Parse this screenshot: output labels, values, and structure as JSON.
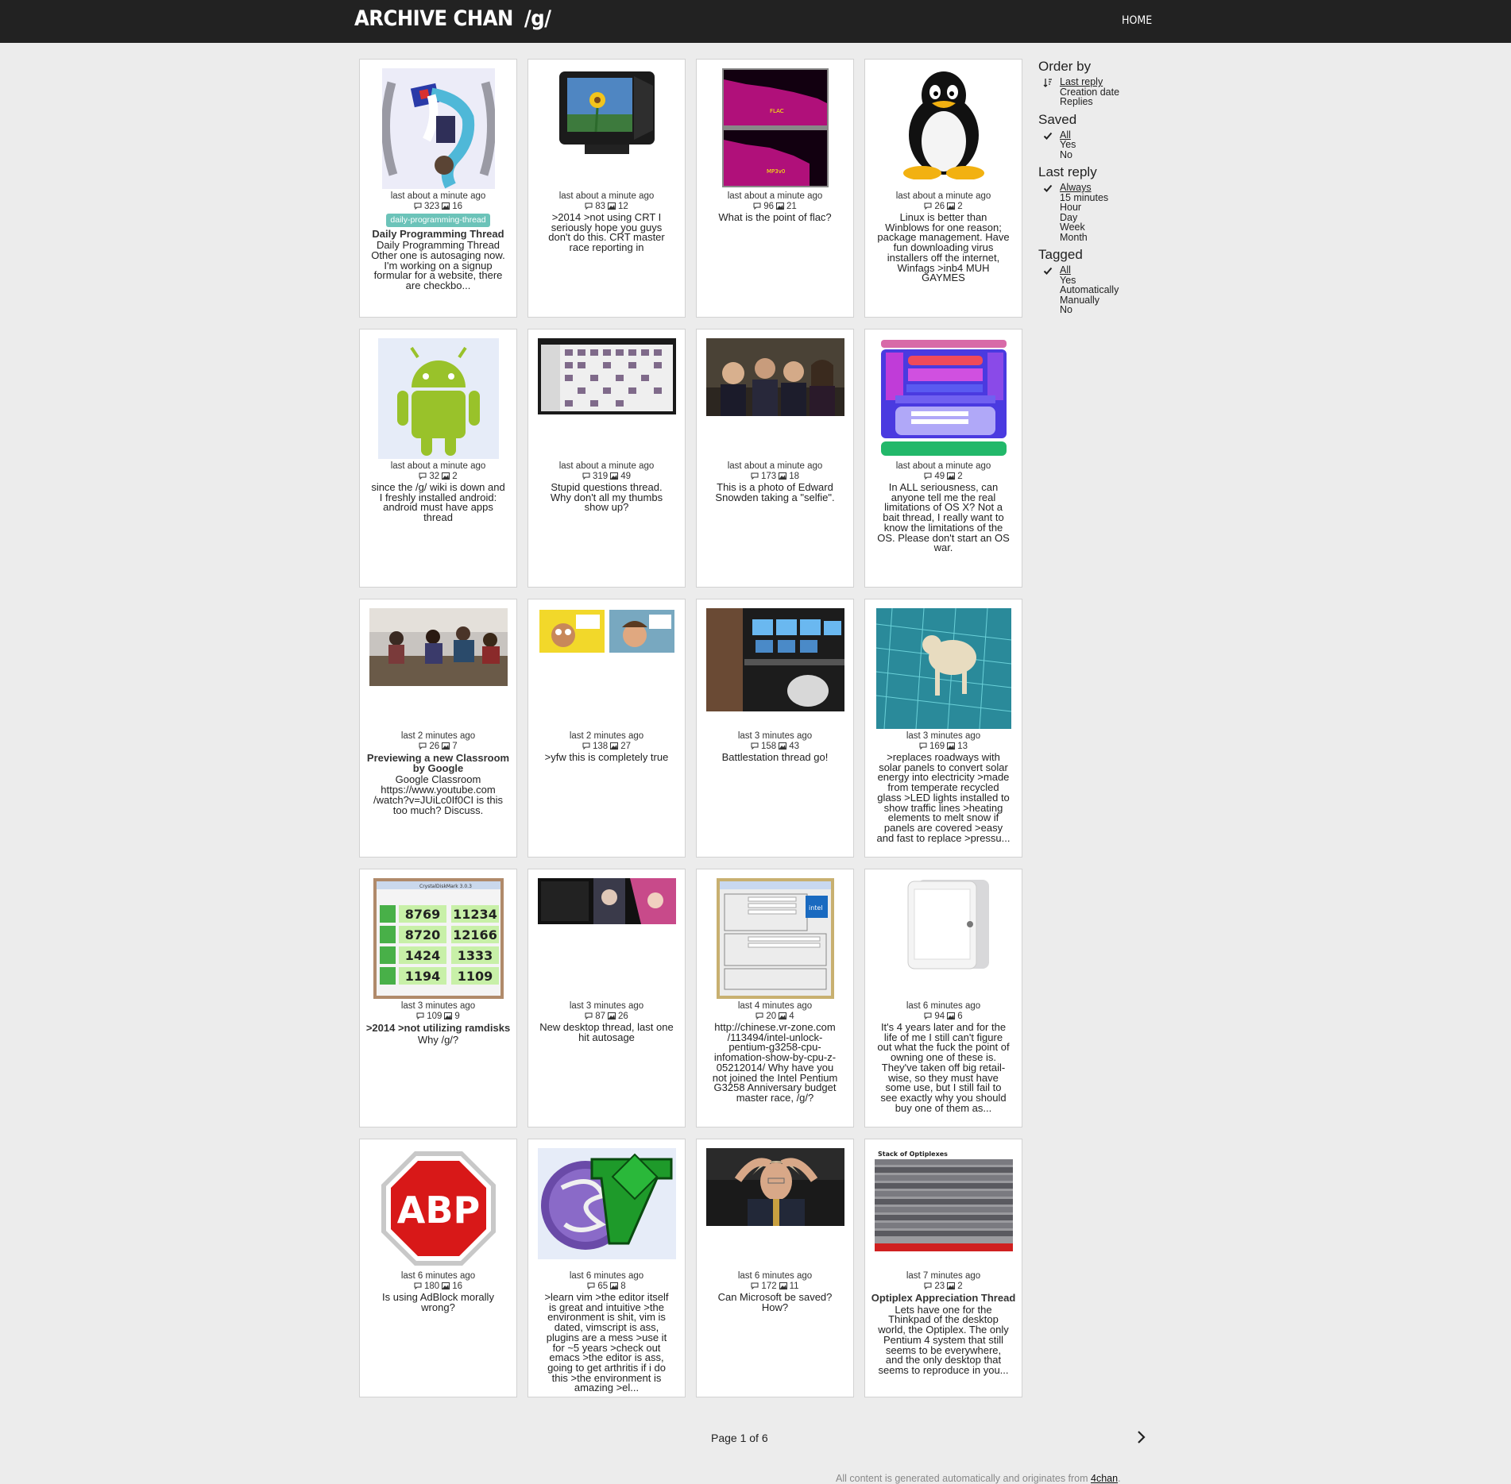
{
  "header": {
    "site_title": "ARCHIVE CHAN",
    "board": "/g/",
    "home_label": "HOME"
  },
  "threads": [
    {
      "last": "last about a minute ago",
      "replies": "323",
      "images": "16",
      "tag": "daily-programming-thread",
      "title": "Daily Programming Thread",
      "body": "Daily Programming Thread Other one is autosaging now. I'm working on a signup formular for a website, there are checkbo...",
      "thumb": "anime-girl"
    },
    {
      "last": "last about a minute ago",
      "replies": "83",
      "images": "12",
      "body": ">2014 >not using CRT I seriously hope you guys don't do this. CRT master race reporting in",
      "thumb": "crt-monitor"
    },
    {
      "last": "last about a minute ago",
      "replies": "96",
      "images": "21",
      "body": "What is the point of flac?",
      "thumb": "spectrogram"
    },
    {
      "last": "last about a minute ago",
      "replies": "26",
      "images": "2",
      "body": "Linux is better than Winblows for one reason; package management. Have fun downloading virus installers off the internet, Winfags >inb4 MUH GAYMES",
      "thumb": "tux"
    },
    {
      "last": "last about a minute ago",
      "replies": "32",
      "images": "2",
      "body": "since the /g/ wiki is down and I freshly installed android: android must have apps thread",
      "thumb": "android"
    },
    {
      "last": "last about a minute ago",
      "replies": "319",
      "images": "49",
      "body": "Stupid questions thread. Why don't all my thumbs show up?",
      "thumb": "file-browser"
    },
    {
      "last": "last about a minute ago",
      "replies": "173",
      "images": "18",
      "body": "This is a photo of Edward Snowden taking a \"selfie\".",
      "thumb": "group-photo"
    },
    {
      "last": "last about a minute ago",
      "replies": "49",
      "images": "2",
      "body": "In ALL seriousness, can anyone tell me the real limitations of OS X? Not a bait thread, I really want to know the limitations of the OS. Please don't start an OS war.",
      "thumb": "osx-diagram"
    },
    {
      "last": "last 2 minutes ago",
      "replies": "26",
      "images": "7",
      "title": "Previewing a new Classroom by Google",
      "body": "Google Classroom https://www.youtube.com /watch?v=JUiLc0If0CI is this too much? Discuss.",
      "thumb": "classroom"
    },
    {
      "last": "last 2 minutes ago",
      "replies": "138",
      "images": "27",
      "body": ">yfw this is completely true",
      "thumb": "comic"
    },
    {
      "last": "last 3 minutes ago",
      "replies": "158",
      "images": "43",
      "body": "Battlestation thread go!",
      "thumb": "battlestation"
    },
    {
      "last": "last 3 minutes ago",
      "replies": "169",
      "images": "13",
      "body": ">replaces roadways with solar panels to convert solar energy into electricity >made from temperate recycled glass >LED lights installed to show traffic lines >heating elements to melt snow if panels are covered >easy and fast to replace >pressu...",
      "thumb": "dog-solar"
    },
    {
      "last": "last 3 minutes ago",
      "replies": "109",
      "images": "9",
      "title": ">2014 >not utilizing ramdisks",
      "body": "Why /g/?",
      "thumb": "crystaldisk",
      "disk": {
        "title": "CrystalDiskMark 3.0.3",
        "read": [
          "8769",
          "8720",
          "1424",
          "1194"
        ],
        "write": [
          "11234",
          "12166",
          "1333",
          "1109"
        ]
      }
    },
    {
      "last": "last 3 minutes ago",
      "replies": "87",
      "images": "26",
      "body": "New desktop thread, last one hit autosage",
      "thumb": "desktop"
    },
    {
      "last": "last 4 minutes ago",
      "replies": "20",
      "images": "4",
      "body": "http://chinese.vr-zone.com /113494/intel-unlock-pentium-g3258-cpu-infomation-show-by-cpu-z-05212014/ Why have you not joined the Intel Pentium G3258 Anniversary budget master race, /g/?",
      "thumb": "cpuz"
    },
    {
      "last": "last 6 minutes ago",
      "replies": "94",
      "images": "6",
      "body": "It's 4 years later and for the life of me I still can't figure out what the fuck the point of owning one of these is. They've taken off big retail-wise, so they must have some use, but I still fail to see exactly why you should buy one of them as...",
      "thumb": "ipad"
    },
    {
      "last": "last 6 minutes ago",
      "replies": "180",
      "images": "16",
      "body": "Is using AdBlock morally wrong?",
      "thumb": "abp",
      "abp_text": "ABP"
    },
    {
      "last": "last 6 minutes ago",
      "replies": "65",
      "images": "8",
      "body": ">learn vim >the editor itself is great and intuitive >the environment is shit, vim is dated, vimscript is ass, plugins are a mess >use it for ~5 years >check out emacs >the editor is ass, going to get arthritis if i do this >the environment is amazing >el...",
      "thumb": "vim-emacs"
    },
    {
      "last": "last 6 minutes ago",
      "replies": "172",
      "images": "11",
      "body": "Can Microsoft be saved? How?",
      "thumb": "bill-gates"
    },
    {
      "last": "last 7 minutes ago",
      "replies": "23",
      "images": "2",
      "title": "Optiplex Appreciation Thread",
      "body": "Lets have one for the Thinkpad of the desktop world, the Optiplex. The only Pentium 4 system that still seems to be everywhere, and the only desktop that seems to reproduce in you...",
      "thumb": "optiplex",
      "caption": "Stack of Optiplexes"
    }
  ],
  "sidebar": {
    "groups": [
      {
        "heading": "Order by",
        "options": [
          {
            "label": "Last reply",
            "active": true,
            "icon": "sort-desc-icon"
          },
          {
            "label": "Creation date"
          },
          {
            "label": "Replies"
          }
        ]
      },
      {
        "heading": "Saved",
        "options": [
          {
            "label": "All",
            "active": true,
            "icon": "check-icon"
          },
          {
            "label": "Yes"
          },
          {
            "label": "No"
          }
        ]
      },
      {
        "heading": "Last reply",
        "options": [
          {
            "label": "Always",
            "active": true,
            "icon": "check-icon"
          },
          {
            "label": "15 minutes"
          },
          {
            "label": "Hour"
          },
          {
            "label": "Day"
          },
          {
            "label": "Week"
          },
          {
            "label": "Month"
          }
        ]
      },
      {
        "heading": "Tagged",
        "options": [
          {
            "label": "All",
            "active": true,
            "icon": "check-icon"
          },
          {
            "label": "Yes"
          },
          {
            "label": "Automatically"
          },
          {
            "label": "Manually"
          },
          {
            "label": "No"
          }
        ]
      }
    ]
  },
  "pagination": {
    "label": "Page 1 of 6",
    "next_icon": "chevron-right-icon"
  },
  "footer": {
    "text": "All content is generated automatically and originates from ",
    "link": "4chan",
    "suffix": "."
  },
  "colors": {
    "topbar": "#222222",
    "tag": "#6cc3b9",
    "background": "#ececec"
  }
}
